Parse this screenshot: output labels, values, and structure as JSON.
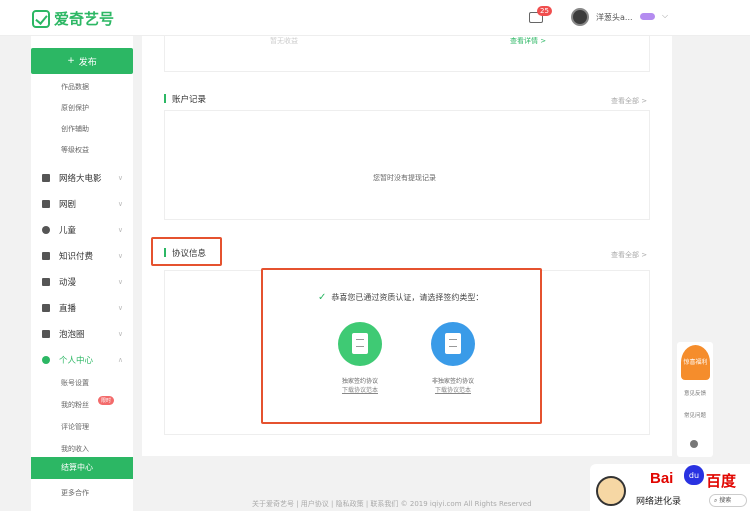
{
  "header": {
    "logo_text": "爱奇艺号",
    "mail_badge": "25",
    "username": "洋葱头a..."
  },
  "sidebar": {
    "publish_label": "发布",
    "sub_items_top": [
      "作品数据",
      "原创保护",
      "创作辅助",
      "等级权益"
    ],
    "nav_items": [
      "网络大电影",
      "网剧",
      "儿童",
      "知识付费",
      "动漫",
      "直播",
      "泡泡圈",
      "个人中心"
    ],
    "sub_items_bottom": [
      "账号设置",
      "我的粉丝",
      "评论管理",
      "我的收入"
    ],
    "red_tag": "限时",
    "active_item": "结算中心",
    "last_item": "更多合作"
  },
  "main": {
    "top_card_left": "暂无收益",
    "top_card_right": "查看详情 >",
    "account_title": "账户记录",
    "see_all": "查看全部 >",
    "empty_text": "您暂时没有提现记录",
    "agreement_title": "协议信息",
    "agreement_see_all": "查看全部 >",
    "prompt": "恭喜您已通过资质认证，请选择签约类型：",
    "option1_label": "独家签约协议",
    "option1_link": "下载协议范本",
    "option2_label": "非独家签约协议",
    "option2_link": "下载协议范本"
  },
  "float": {
    "gift_text": "惊喜福利",
    "text1": "意见反馈",
    "text2": "常见问题"
  },
  "footer": {
    "text": "关于爱奇艺号  |  用户协议  |  隐私政策  |  联系我们    © 2019 iqiyi.com All Rights Reserved"
  },
  "watermark": {
    "bai": "Bai",
    "du": "百度",
    "subtitle": "网络进化录",
    "search": "搜索"
  },
  "colors": {
    "brand": "#2cb764",
    "highlight": "#e5522f",
    "option1": "#3fca74",
    "option2": "#3a9be8"
  }
}
